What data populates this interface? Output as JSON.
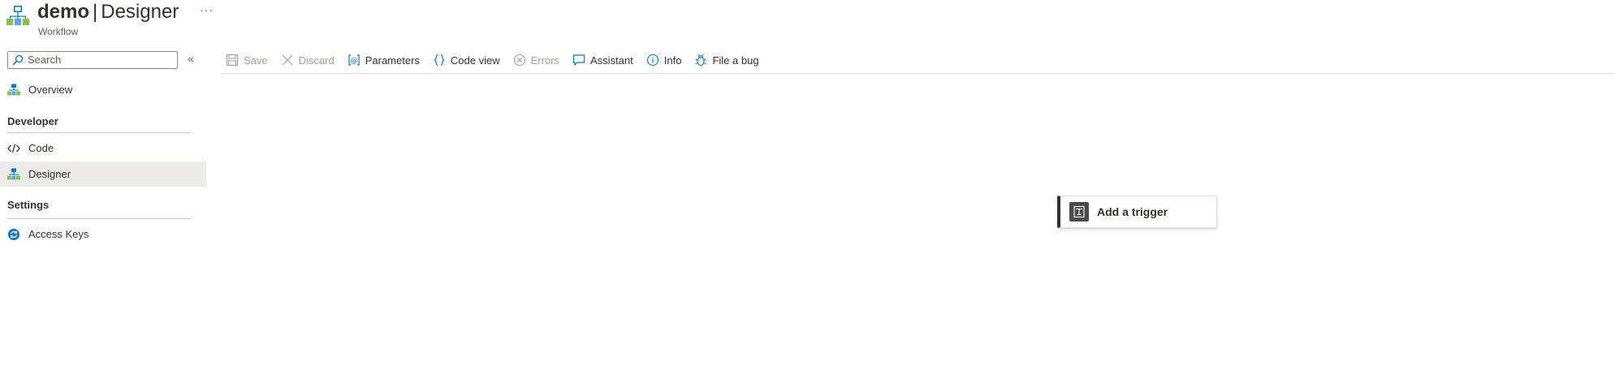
{
  "header": {
    "resource_name": "demo",
    "separator": "|",
    "page_name": "Designer",
    "subtitle": "Workflow",
    "more_label": "···"
  },
  "sidebar": {
    "search_placeholder": "Search",
    "collapse_label": "«",
    "items": [
      {
        "label": "Overview",
        "icon": "workflow-icon"
      },
      {
        "label": "Code",
        "icon": "code-icon"
      },
      {
        "label": "Designer",
        "icon": "workflow-icon",
        "selected": true
      },
      {
        "label": "Access Keys",
        "icon": "refresh-icon"
      }
    ],
    "sections": [
      {
        "title": "Developer"
      },
      {
        "title": "Settings"
      }
    ]
  },
  "toolbar": {
    "save": "Save",
    "discard": "Discard",
    "parameters": "Parameters",
    "code_view": "Code view",
    "errors": "Errors",
    "assistant": "Assistant",
    "info": "Info",
    "file_bug": "File a bug"
  },
  "canvas": {
    "add_trigger": "Add a trigger"
  },
  "colors": {
    "accent": "#0078d4",
    "selected_bg": "#edebe9",
    "disabled_text": "#a19f9d",
    "trigger_border": "#323130"
  }
}
